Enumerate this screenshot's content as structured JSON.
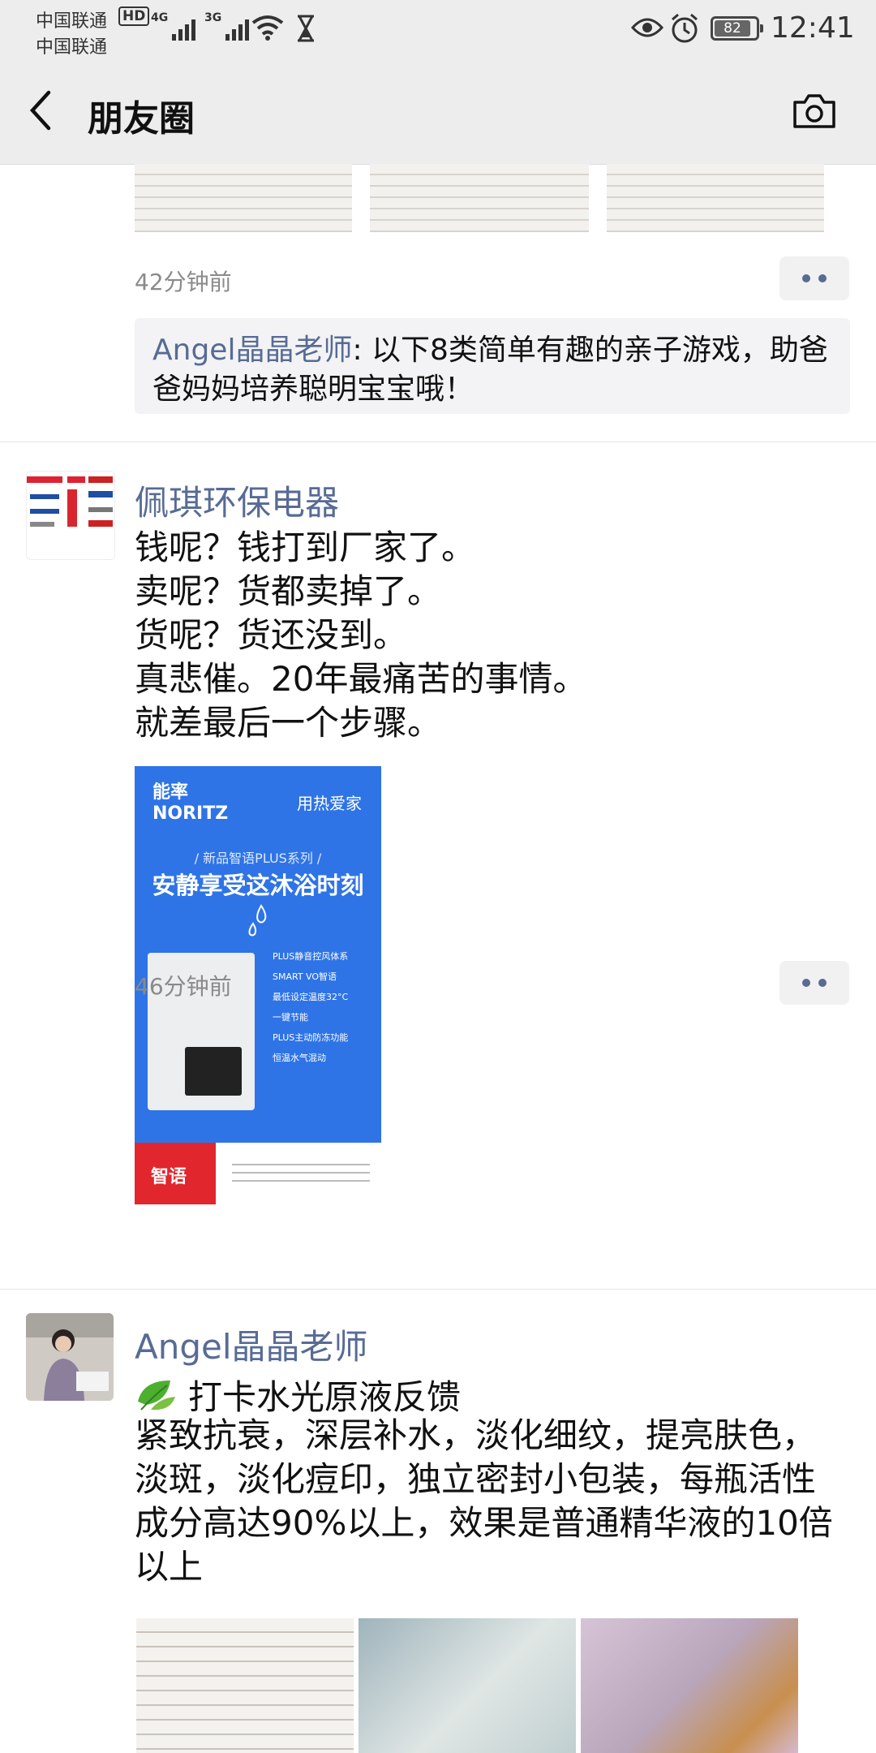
{
  "status_bar": {
    "carrier1": "中国联通",
    "carrier2": "中国联通",
    "hd_badge": "HD",
    "network1": "4G",
    "network2": "3G",
    "battery_level": "82",
    "time": "12:41"
  },
  "nav": {
    "title": "朋友圈"
  },
  "feed": {
    "prev_post": {
      "time": "42分钟前",
      "comment_author": "Angel晶晶老师",
      "comment_separator": ": ",
      "comment_text": "以下8类简单有趣的亲子游戏，助爸爸妈妈培养聪明宝宝哦！"
    },
    "post2": {
      "author": "佩琪环保电器",
      "text": "钱呢？钱打到厂家了。\n卖呢？货都卖掉了。\n货呢？货还没到。\n真悲催。20年最痛苦的事情。\n就差最后一个步骤。",
      "time": "46分钟前",
      "ad": {
        "brand_cn": "能率",
        "brand_en": "NORITZ",
        "tagline": "用热爱家",
        "series": "/ 新品智语PLUS系列 /",
        "headline": "安静享受这沐浴时刻",
        "features": [
          "PLUS静音控风体系",
          "SMART VO智语",
          "最低设定温度32°C",
          "一键节能",
          "PLUS主动防冻功能",
          "恒温水气混动"
        ],
        "footer_label": "智语"
      }
    },
    "post3": {
      "author": "Angel晶晶老师",
      "title": "打卡水光原液反馈",
      "body": "紧致抗衰，深层补水，淡化细纹，提亮肤色，淡斑，淡化痘印，独立密封小包装，每瓶活性成分高达90%以上，效果是普通精华液的10倍以上"
    }
  }
}
